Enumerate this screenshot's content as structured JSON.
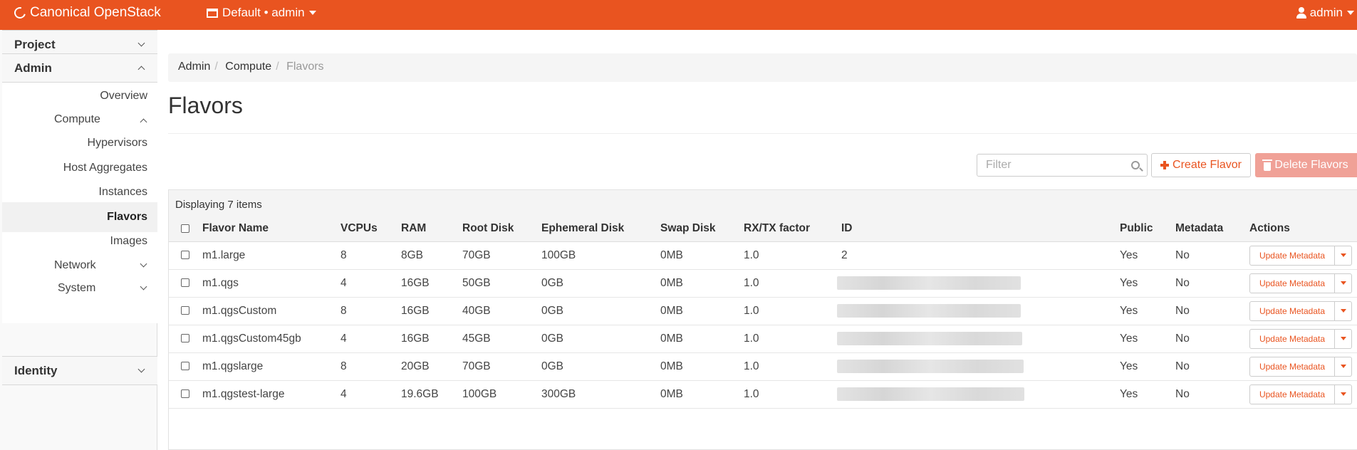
{
  "topbar": {
    "brand": "Canonical OpenStack",
    "project_picker": "Default • admin",
    "user": "admin"
  },
  "sidebar": {
    "project": "Project",
    "admin": "Admin",
    "overview": "Overview",
    "compute": "Compute",
    "hypervisors": "Hypervisors",
    "host_aggregates": "Host Aggregates",
    "instances": "Instances",
    "flavors": "Flavors",
    "images": "Images",
    "network": "Network",
    "system": "System",
    "identity": "Identity"
  },
  "breadcrumb": [
    "Admin",
    "Compute",
    "Flavors"
  ],
  "page_title": "Flavors",
  "toolbar": {
    "filter_placeholder": "Filter",
    "create_label": "Create Flavor",
    "delete_label": "Delete Flavors"
  },
  "table": {
    "caption": "Displaying 7 items",
    "columns": [
      "Flavor Name",
      "VCPUs",
      "RAM",
      "Root Disk",
      "Ephemeral Disk",
      "Swap Disk",
      "RX/TX factor",
      "ID",
      "Public",
      "Metadata",
      "Actions"
    ],
    "action_label": "Update Metadata",
    "rows": [
      {
        "name": "m1.large",
        "vcpus": "8",
        "ram": "8GB",
        "root": "70GB",
        "ephemeral": "100GB",
        "swap": "0MB",
        "rxtx": "1.0",
        "id": "2",
        "public": "Yes",
        "metadata": "No"
      },
      {
        "name": "m1.qgs",
        "vcpus": "4",
        "ram": "16GB",
        "root": "50GB",
        "ephemeral": "0GB",
        "swap": "0MB",
        "rxtx": "1.0",
        "id": "",
        "public": "Yes",
        "metadata": "No"
      },
      {
        "name": "m1.qgsCustom",
        "vcpus": "8",
        "ram": "16GB",
        "root": "40GB",
        "ephemeral": "0GB",
        "swap": "0MB",
        "rxtx": "1.0",
        "id": "",
        "public": "Yes",
        "metadata": "No"
      },
      {
        "name": "m1.qgsCustom45gb",
        "vcpus": "4",
        "ram": "16GB",
        "root": "45GB",
        "ephemeral": "0GB",
        "swap": "0MB",
        "rxtx": "1.0",
        "id": "",
        "public": "Yes",
        "metadata": "No"
      },
      {
        "name": "m1.qgslarge",
        "vcpus": "8",
        "ram": "20GB",
        "root": "70GB",
        "ephemeral": "0GB",
        "swap": "0MB",
        "rxtx": "1.0",
        "id": "",
        "public": "Yes",
        "metadata": "No"
      },
      {
        "name": "m1.qgstest-large",
        "vcpus": "4",
        "ram": "19.6GB",
        "root": "100GB",
        "ephemeral": "300GB",
        "swap": "0MB",
        "rxtx": "1.0",
        "id": "",
        "public": "Yes",
        "metadata": "No"
      }
    ]
  }
}
